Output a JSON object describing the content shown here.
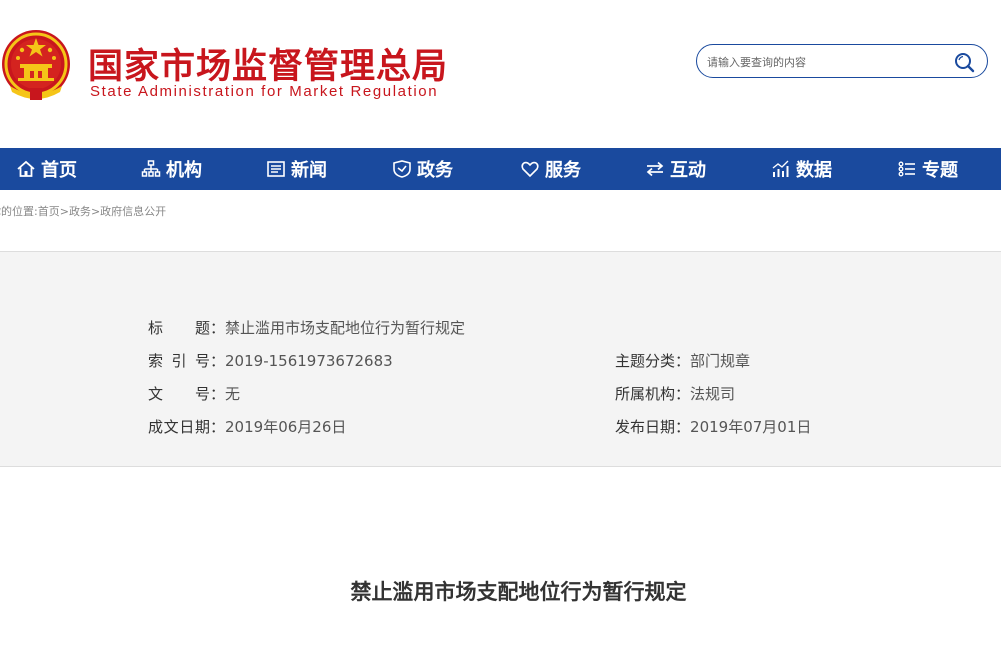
{
  "header": {
    "title_cn": "国家市场监督管理总局",
    "title_en": "State Administration for Market Regulation",
    "brand_color": "#c8161d"
  },
  "search": {
    "placeholder": "请输入要查询的内容",
    "icon": "search-icon"
  },
  "nav": {
    "color": "#1a4a9e",
    "items": [
      {
        "label": "首页",
        "icon": "home-icon"
      },
      {
        "label": "机构",
        "icon": "org-chart-icon"
      },
      {
        "label": "新闻",
        "icon": "news-icon"
      },
      {
        "label": "政务",
        "icon": "shield-icon"
      },
      {
        "label": "服务",
        "icon": "heart-icon"
      },
      {
        "label": "互动",
        "icon": "exchange-icon"
      },
      {
        "label": "数据",
        "icon": "chart-icon"
      },
      {
        "label": "专题",
        "icon": "list-icon"
      }
    ]
  },
  "breadcrumb": {
    "prefix": "你的位置:",
    "items": [
      "首页",
      "政务",
      "政府信息公开"
    ],
    "separator": ">"
  },
  "info": {
    "title_label": "标 题",
    "title_value": "禁止滥用市场支配地位行为暂行规定",
    "index_label": "索 引 号",
    "index_value": "2019-1561973672683",
    "topic_label": "主题分类",
    "topic_value": "部门规章",
    "doc_label": "文 号",
    "doc_value": "无",
    "agency_label": "所属机构",
    "agency_value": "法规司",
    "written_label": "成文日期",
    "written_value": "2019年06月26日",
    "published_label": "发布日期",
    "published_value": "2019年07月01日",
    "colon": "："
  },
  "article": {
    "title": "禁止滥用市场支配地位行为暂行规定"
  }
}
